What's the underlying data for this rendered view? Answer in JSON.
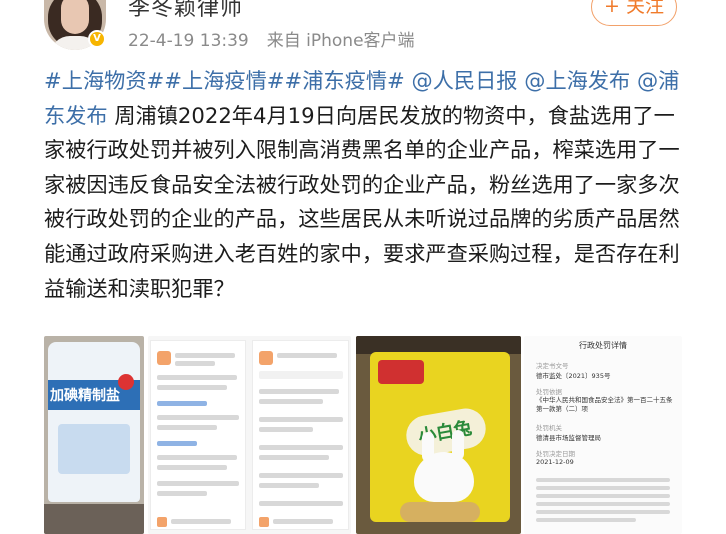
{
  "header": {
    "username": "李冬颖律师",
    "verified_badge": "V",
    "date": "22-4-19 13:39",
    "source": "来自 iPhone客户端",
    "follow_label": "+ 关注"
  },
  "post": {
    "tags": [
      "#上海物资#",
      "#上海疫情#",
      "#浦东疫情#"
    ],
    "mentions": [
      "@人民日报",
      "@上海发布",
      "@浦东发布"
    ],
    "body": "周浦镇2022年4月19日向居民发放的物资中，食盐选用了一家被行政处罚并被列入限制高消费黑名单的企业产品，榨菜选用了一家被因违反食品安全法被行政处罚的企业产品，粉丝选用了一家多次被行政处罚的企业的产品，这些居民从未听说过品牌的劣质产品居然能通过政府采购进入老百姓的家中，要求严查采购过程，是否存在利益输送和渎职犯罪？"
  },
  "images": {
    "salt_bag_text": "加碘精制盐",
    "noodle_bag_text": "小白兔",
    "doc_title": "行政处罚详情",
    "doc_fields": [
      {
        "label": "决定书文号",
        "value": "德市监处〔2021〕935号"
      },
      {
        "label": "处罚依据",
        "value": "《中华人民共和国食品安全法》第一百二十五条第一款第（二）项"
      },
      {
        "label": "处罚机关",
        "value": "德清县市场监督管理局"
      },
      {
        "label": "处罚决定日期",
        "value": "2021-12-09"
      }
    ]
  }
}
